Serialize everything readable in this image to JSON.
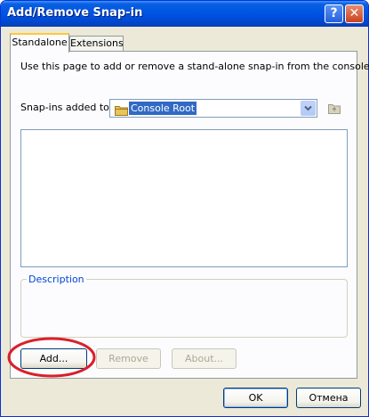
{
  "window": {
    "title": "Add/Remove Snap-in",
    "help_label": "?",
    "close_label": "✕"
  },
  "tabs": [
    {
      "label": "Standalone",
      "active": true
    },
    {
      "label": "Extensions",
      "active": false
    }
  ],
  "standalone": {
    "intro": "Use this page to add or remove a stand-alone snap-in from the console.",
    "snapins_label": "Snap-ins added to:",
    "snapins_value": "Console Root",
    "combo_icon": "folder-icon",
    "up_level_icon": "folder-up-icon",
    "description_label": "Description",
    "buttons": {
      "add": "Add...",
      "remove": "Remove",
      "about": "About..."
    }
  },
  "footer": {
    "ok": "OK",
    "cancel": "Отмена"
  },
  "annotation": {
    "color": "#d9202a",
    "shape": "ellipse"
  }
}
